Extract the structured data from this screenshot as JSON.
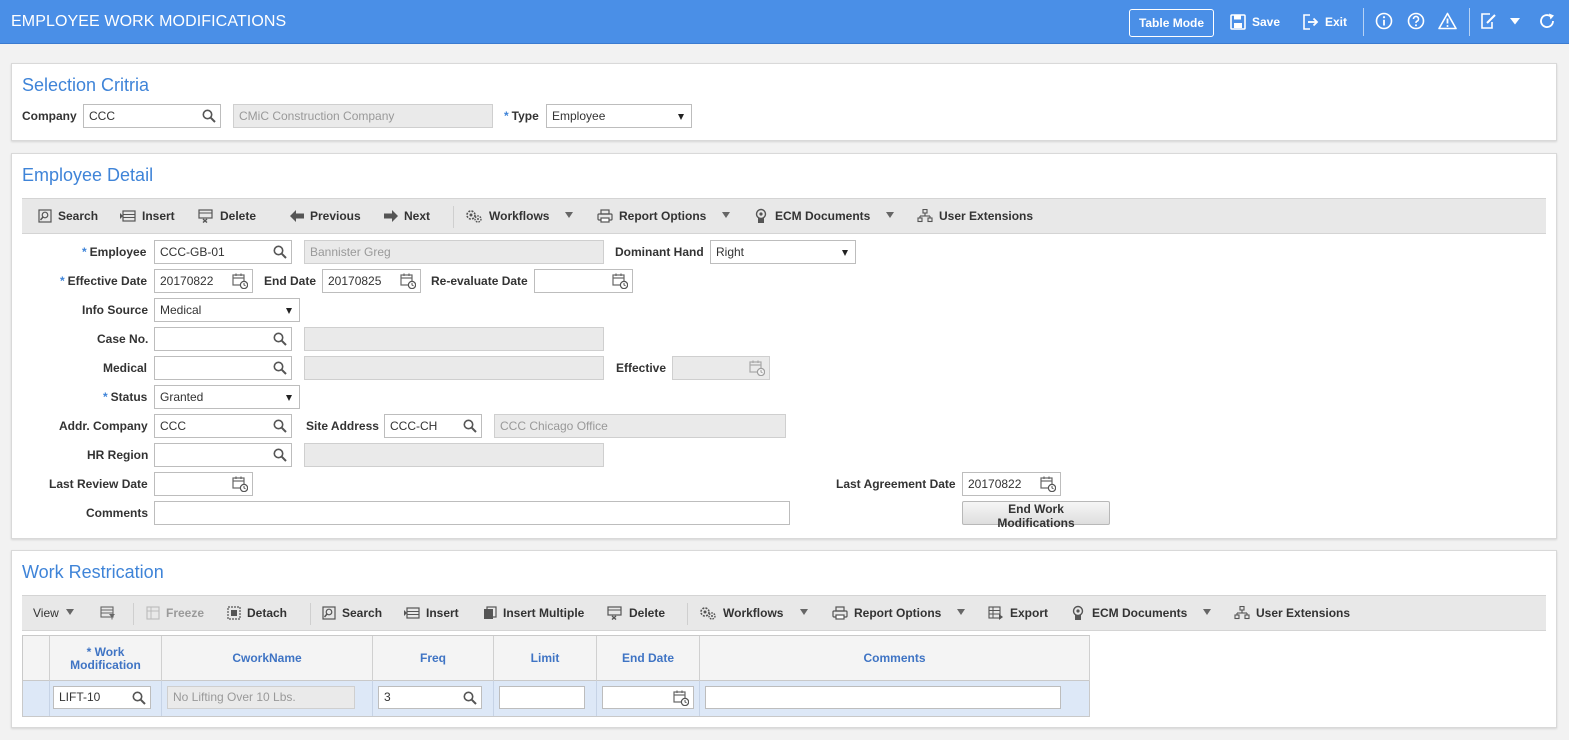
{
  "app": {
    "title": "EMPLOYEE WORK MODIFICATIONS",
    "table_mode_label": "Table Mode",
    "save_label": "Save",
    "exit_label": "Exit",
    "accent_color": "#4a8fe7"
  },
  "selection": {
    "title": "Selection Critria",
    "company_label": "Company",
    "company_value": "CCC",
    "company_name": "CMiC Construction Company",
    "type_label": "Type",
    "type_value": "Employee"
  },
  "employee_detail": {
    "title": "Employee Detail",
    "toolbar": {
      "search": "Search",
      "insert": "Insert",
      "delete": "Delete",
      "previous": "Previous",
      "next": "Next",
      "workflows": "Workflows",
      "report_options": "Report Options",
      "ecm_documents": "ECM Documents",
      "user_extensions": "User Extensions"
    },
    "fields": {
      "employee_label": "Employee",
      "employee_value": "CCC-GB-01",
      "employee_name": "Bannister Greg",
      "dominant_hand_label": "Dominant Hand",
      "dominant_hand_value": "Right",
      "effective_date_label": "Effective Date",
      "effective_date_value": "20170822",
      "end_date_label": "End Date",
      "end_date_value": "20170825",
      "reevaluate_date_label": "Re-evaluate Date",
      "reevaluate_date_value": "",
      "info_source_label": "Info Source",
      "info_source_value": "Medical",
      "case_no_label": "Case No.",
      "case_no_value": "",
      "medical_label": "Medical",
      "medical_value": "",
      "effective_label": "Effective",
      "status_label": "Status",
      "status_value": "Granted",
      "addr_company_label": "Addr. Company",
      "addr_company_value": "CCC",
      "site_address_label": "Site Address",
      "site_address_value": "CCC-CH",
      "site_address_name": "CCC Chicago Office",
      "hr_region_label": "HR Region",
      "hr_region_value": "",
      "last_review_date_label": "Last Review Date",
      "last_review_date_value": "",
      "last_agreement_date_label": "Last Agreement Date",
      "last_agreement_date_value": "20170822",
      "comments_label": "Comments",
      "comments_value": "",
      "end_work_mod_button": "End Work Modifications"
    }
  },
  "work_restriction": {
    "title": "Work Restrication",
    "toolbar": {
      "view": "View",
      "freeze": "Freeze",
      "detach": "Detach",
      "search": "Search",
      "insert": "Insert",
      "insert_multiple": "Insert Multiple",
      "delete": "Delete",
      "workflows": "Workflows",
      "report_options": "Report Options",
      "export": "Export",
      "ecm_documents": "ECM Documents",
      "user_extensions": "User Extensions"
    },
    "columns": {
      "work_modification_req": "*",
      "work_modification": "Work Modification",
      "cworkname": "CworkName",
      "freq": "Freq",
      "limit": "Limit",
      "end_date": "End Date",
      "comments": "Comments"
    },
    "rows": [
      {
        "work_modification": "LIFT-10",
        "cworkname": "No Lifting Over 10 Lbs.",
        "freq": "3",
        "limit": "",
        "end_date": "",
        "comments": ""
      }
    ]
  }
}
